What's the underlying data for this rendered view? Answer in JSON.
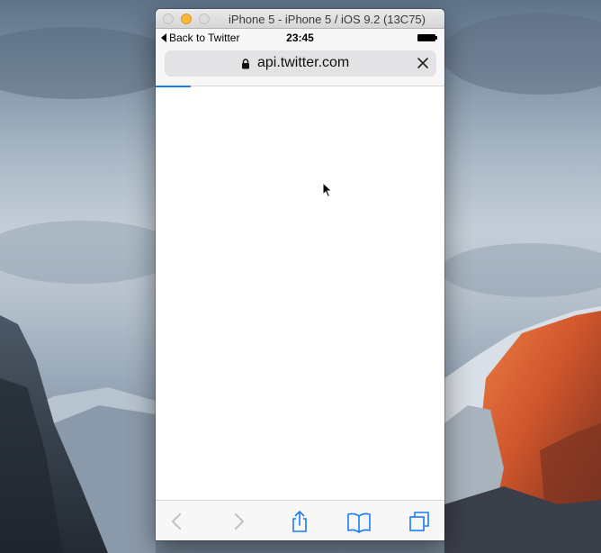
{
  "window": {
    "title": "iPhone 5 - iPhone 5 / iOS 9.2 (13C75)"
  },
  "status_bar": {
    "back_label": "Back to Twitter",
    "time": "23:45",
    "battery_icon": "battery-full-icon"
  },
  "safari": {
    "url": "api.twitter.com",
    "lock_icon": "lock-icon",
    "clear_icon": "close-icon",
    "load_progress": 0.12,
    "accent_color": "#1a7cf5"
  },
  "toolbar": {
    "icons": [
      "back-arrow-icon",
      "forward-arrow-icon",
      "share-icon",
      "bookmarks-icon",
      "tabs-icon"
    ]
  }
}
